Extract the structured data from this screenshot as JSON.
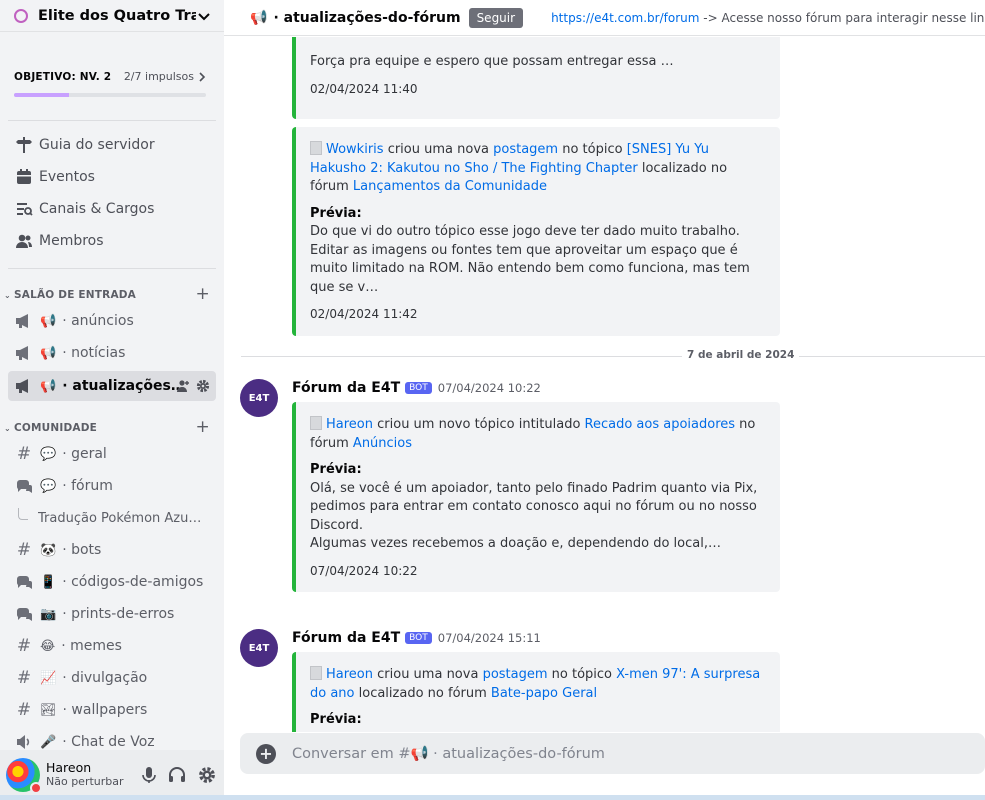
{
  "server": {
    "name": "Elite dos Quatro Trad…"
  },
  "boost": {
    "goal": "OBJETIVO: NV. 2",
    "count": "2/7 impulsos",
    "progress": 0.286
  },
  "nav": [
    {
      "label": "Guia do servidor",
      "icon": "signpost-icon"
    },
    {
      "label": "Eventos",
      "icon": "calendar-icon"
    },
    {
      "label": "Canais & Cargos",
      "icon": "channels-roles-icon"
    },
    {
      "label": "Membros",
      "icon": "members-icon"
    }
  ],
  "categories": {
    "entrada": "SALÃO DE ENTRADA",
    "comunidade": "COMUNIDADE"
  },
  "channels_entrada": [
    {
      "emoji": "📢",
      "name": "· anúncios"
    },
    {
      "emoji": "📢",
      "name": "· notícias"
    },
    {
      "emoji": "📢",
      "name": "· atualizações…"
    }
  ],
  "channels_comunidade": [
    {
      "emoji": "💬",
      "name": "· geral",
      "type": "#"
    },
    {
      "emoji": "💬",
      "name": "· fórum",
      "type": "forum"
    },
    {
      "emoji": "🐼",
      "name": "· bots",
      "type": "#"
    },
    {
      "emoji": "📱",
      "name": "· códigos-de-amigos",
      "type": "forum"
    },
    {
      "emoji": "📷",
      "name": "· prints-de-erros",
      "type": "forum"
    },
    {
      "emoji": "😂",
      "name": "· memes",
      "type": "#"
    },
    {
      "emoji": "📈",
      "name": "· divulgação",
      "type": "#"
    },
    {
      "emoji": "🏞",
      "name": "· wallpapers",
      "type": "#"
    },
    {
      "emoji": "🎤",
      "name": "· Chat de Voz",
      "type": "voice"
    }
  ],
  "thread": {
    "name": "Tradução Pokémon Azu…"
  },
  "user": {
    "name": "Hareon",
    "status": "Não perturbar"
  },
  "topbar": {
    "emoji": "📢",
    "title": "· atualizações-do-fórum",
    "follow": "Seguir",
    "topic_link": "https://e4t.com.br/forum",
    "topic_text": " -> Acesse nosso fórum para interagir nesse link."
  },
  "messages": {
    "m1": {
      "text": "Força pra equipe e espero que possam entregar essa …",
      "time": "02/04/2024 11:40"
    },
    "m2": {
      "author_link": "Wowkiris",
      "t1": " criou uma nova ",
      "post_link": "postagem",
      "t2": " no tópico ",
      "topic_link": "[SNES] Yu Yu Hakusho 2: Kakutou no Sho / The Fighting Chapter",
      "t3": " localizado no fórum ",
      "forum_link": "Lançamentos da Comunidade",
      "preview_label": "Prévia:",
      "preview": "Do que vi do outro tópico esse jogo deve ter dado muito trabalho. Editar as imagens ou fontes tem que aproveitar um espaço que é muito limitado na ROM. Não entendo bem como funciona, mas tem que se v…",
      "time": "02/04/2024 11:42"
    },
    "date_divider": "7 de abril de 2024",
    "m3": {
      "bot_name": "Fórum da E4T",
      "bot_tag": "BOT",
      "post_time": "07/04/2024 10:22",
      "author_link": "Hareon",
      "t1": " criou um novo tópico intitulado ",
      "title_link": "Recado aos apoiadores",
      "t2": " no fórum ",
      "forum_link": "Anúncios",
      "preview_label": "Prévia:",
      "preview1": "Olá, se você é um apoiador, tanto pelo finado Padrim quanto via Pix, pedimos para entrar em contato conosco aqui no fórum ou no nosso Discord.",
      "preview2": "Algumas vezes recebemos a doação e, dependendo do local,…",
      "time": "07/04/2024 10:22"
    },
    "m4": {
      "bot_name": "Fórum da E4T",
      "bot_tag": "BOT",
      "post_time": "07/04/2024 15:11",
      "author_link": "Hareon",
      "t1": " criou uma nova ",
      "post_link": "postagem",
      "t2": " no tópico ",
      "topic_link": "X-men 97': A surpresa do ano",
      "t3": " localizado no fórum ",
      "forum_link": "Bate-papo Geral",
      "preview_label": "Prévia:"
    }
  },
  "composer": {
    "placeholder": "Conversar em #📢 · atualizações-do-fórum"
  },
  "colors": {
    "accent_green": "#24b43b",
    "link": "#006ce7",
    "bot_badge": "#5865f2"
  }
}
